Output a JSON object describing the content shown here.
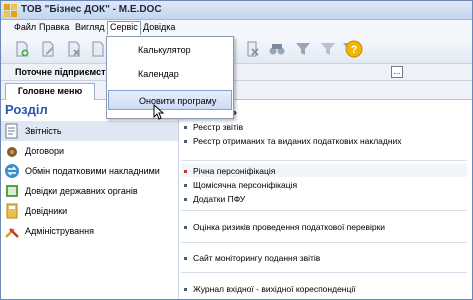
{
  "window": {
    "title": "ТОВ \"Бізнес ДОК\" - M.E.DOC"
  },
  "menubar": {
    "items": [
      "Файл",
      "Правка",
      "Вигляд",
      "Сервіс",
      "Довідка"
    ],
    "active": "Сервіс"
  },
  "service_menu": {
    "items": [
      "Калькулятор",
      "Календар",
      "Оновити програму"
    ],
    "highlighted": "Оновити програму"
  },
  "enterprise": {
    "label": "Поточне підприємств",
    "browse_label": "..."
  },
  "tabs": [
    "Головне меню"
  ],
  "sidebar": {
    "header": "Розділ",
    "items": [
      {
        "label": "Звітність",
        "icon": "reports-icon"
      },
      {
        "label": "Договори",
        "icon": "contracts-icon"
      },
      {
        "label": "Обмін податковими накладними",
        "icon": "exchange-icon"
      },
      {
        "label": "Довідки державних органів",
        "icon": "gov-certificates-icon"
      },
      {
        "label": "Довідники",
        "icon": "directories-icon"
      },
      {
        "label": "Адміністрування",
        "icon": "admin-tools-icon"
      }
    ],
    "selected": "Звітність"
  },
  "main": {
    "section_caption": "ь",
    "links": [
      "Реєстр звітів",
      "Реєстр отриманих та виданих податкових накладних",
      "Річна персоніфікація",
      "Щомісячна персоніфікація",
      "Додатки ПФУ",
      "Оцінка ризиків проведення податкової перевірки",
      "Сайт моніторингу подання звітів",
      "Журнал вхідної - вихідної кореспонденції"
    ]
  },
  "colors": {
    "accent": "#2b58a8",
    "selection": "#dfe7f3",
    "menu_hover": "#cddcf3"
  }
}
